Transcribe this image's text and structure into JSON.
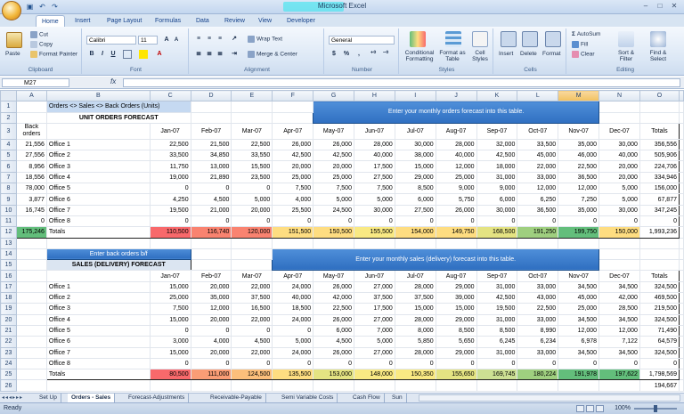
{
  "app": {
    "title": "Microsoft Excel",
    "quick_access": [
      "save-icon",
      "undo-icon",
      "redo-icon"
    ],
    "window_buttons": [
      "–",
      "□",
      "✕"
    ]
  },
  "ribbon_tabs": [
    "Home",
    "Insert",
    "Page Layout",
    "Formulas",
    "Data",
    "Review",
    "View",
    "Developer"
  ],
  "ribbon": {
    "clipboard": {
      "paste": "Paste",
      "cut": "Cut",
      "copy": "Copy",
      "format_painter": "Format Painter",
      "label": "Clipboard"
    },
    "font": {
      "name": "Calibri",
      "size": "11",
      "label": "Font",
      "bold": "B",
      "italic": "I",
      "underline": "U"
    },
    "alignment": {
      "wrap": "Wrap Text",
      "merge": "Merge & Center",
      "label": "Alignment"
    },
    "number": {
      "format": "General",
      "currency": "$",
      "percent": "%",
      "comma": ",",
      "label": "Number"
    },
    "styles": {
      "conditional": "Conditional Formatting",
      "format_table": "Format as Table",
      "cell_styles": "Cell Styles",
      "label": "Styles"
    },
    "cells": {
      "insert": "Insert",
      "delete": "Delete",
      "format": "Format",
      "label": "Cells"
    },
    "editing": {
      "autosum": "AutoSum",
      "fill": "Fill",
      "clear": "Clear",
      "sort": "Sort & Filter",
      "find": "Find & Select",
      "label": "Editing"
    }
  },
  "formula_bar": {
    "name_box": "M27",
    "fx": "fx",
    "formula": ""
  },
  "columns": [
    "A",
    "B",
    "C",
    "D",
    "E",
    "F",
    "G",
    "H",
    "I",
    "J",
    "K",
    "L",
    "M",
    "N",
    "O"
  ],
  "sheet": {
    "title1": "Orders <> Sales <> Back Orders (Units)",
    "unit_orders_title": "UNIT ORDERS FORECAST",
    "note_monthly_orders": "Enter your monthly  orders forecast into this table.",
    "back_orders_label": "Back orders",
    "months": [
      "Jan-07",
      "Feb-07",
      "Mar-07",
      "Apr-07",
      "May-07",
      "Jun-07",
      "Jul-07",
      "Aug-07",
      "Sep-07",
      "Oct-07",
      "Nov-07",
      "Dec-07"
    ],
    "totals_label": "Totals",
    "orders_rows": [
      {
        "row": "4",
        "back": "21,556",
        "office": "Office 1",
        "values": [
          "22,500",
          "21,500",
          "22,500",
          "26,000",
          "26,000",
          "28,000",
          "30,000",
          "28,000",
          "32,000",
          "33,500",
          "35,000",
          "30,000"
        ],
        "total": "356,556"
      },
      {
        "row": "5",
        "back": "27,556",
        "office": "Office 2",
        "values": [
          "33,500",
          "34,850",
          "33,550",
          "42,500",
          "42,500",
          "40,000",
          "38,000",
          "40,000",
          "42,500",
          "45,000",
          "46,000",
          "40,000"
        ],
        "total": "505,906"
      },
      {
        "row": "6",
        "back": "8,956",
        "office": "Office 3",
        "values": [
          "11,750",
          "13,000",
          "15,500",
          "20,000",
          "20,000",
          "17,500",
          "15,000",
          "12,000",
          "18,000",
          "22,000",
          "22,500",
          "20,000"
        ],
        "total": "224,706"
      },
      {
        "row": "7",
        "back": "18,556",
        "office": "Office 4",
        "values": [
          "19,000",
          "21,890",
          "23,500",
          "25,000",
          "25,000",
          "27,500",
          "29,000",
          "25,000",
          "31,000",
          "33,000",
          "36,500",
          "20,000"
        ],
        "total": "334,946"
      },
      {
        "row": "8",
        "back": "78,000",
        "office": "Office 5",
        "values": [
          "0",
          "0",
          "0",
          "7,500",
          "7,500",
          "7,500",
          "8,500",
          "9,000",
          "9,000",
          "12,000",
          "12,000",
          "5,000"
        ],
        "total": "156,000"
      },
      {
        "row": "9",
        "back": "3,877",
        "office": "Office 6",
        "values": [
          "4,250",
          "4,500",
          "5,000",
          "4,000",
          "5,000",
          "5,000",
          "6,000",
          "5,750",
          "6,000",
          "6,250",
          "7,250",
          "5,000"
        ],
        "total": "67,877"
      },
      {
        "row": "10",
        "back": "16,745",
        "office": "Office 7",
        "values": [
          "19,500",
          "21,000",
          "20,000",
          "25,500",
          "24,500",
          "30,000",
          "27,500",
          "26,000",
          "30,000",
          "36,500",
          "35,000",
          "30,000"
        ],
        "total": "347,245"
      },
      {
        "row": "11",
        "back": "0",
        "office": "Office 8",
        "values": [
          "0",
          "0",
          "0",
          "0",
          "0",
          "0",
          "0",
          "0",
          "0",
          "0",
          "0",
          "0"
        ],
        "total": "0"
      }
    ],
    "orders_totals": {
      "row": "12",
      "back": "175,246",
      "label": "Totals",
      "values": [
        "110,500",
        "116,740",
        "120,000",
        "151,500",
        "150,500",
        "155,500",
        "154,000",
        "149,750",
        "168,500",
        "191,250",
        "199,750",
        "150,000"
      ],
      "total": "1,993,236"
    },
    "note_back_orders": "Enter back orders b/f",
    "note_monthly_sales": "Enter your monthly sales (delivery) forecast into this table.",
    "sales_title": "SALES (DELIVERY) FORECAST",
    "sales_rows": [
      {
        "row": "17",
        "office": "Office 1",
        "values": [
          "15,000",
          "20,000",
          "22,000",
          "24,000",
          "26,000",
          "27,000",
          "28,000",
          "29,000",
          "31,000",
          "33,000",
          "34,500",
          "34,500"
        ],
        "total": "324,500"
      },
      {
        "row": "18",
        "office": "Office 2",
        "values": [
          "25,000",
          "35,000",
          "37,500",
          "40,000",
          "42,000",
          "37,500",
          "37,500",
          "39,000",
          "42,500",
          "43,000",
          "45,000",
          "42,000"
        ],
        "total": "469,500"
      },
      {
        "row": "19",
        "office": "Office 3",
        "values": [
          "7,500",
          "12,000",
          "16,500",
          "18,500",
          "22,500",
          "17,500",
          "15,000",
          "15,000",
          "19,500",
          "22,500",
          "25,000",
          "28,500"
        ],
        "total": "219,500"
      },
      {
        "row": "20",
        "office": "Office 4",
        "values": [
          "15,000",
          "20,000",
          "22,000",
          "24,000",
          "26,000",
          "27,000",
          "28,000",
          "29,000",
          "31,000",
          "33,000",
          "34,500",
          "34,500"
        ],
        "total": "324,500"
      },
      {
        "row": "21",
        "office": "Office 5",
        "values": [
          "0",
          "0",
          "0",
          "0",
          "6,000",
          "7,000",
          "8,000",
          "8,500",
          "8,500",
          "8,990",
          "12,000",
          "12,000"
        ],
        "total": "71,490"
      },
      {
        "row": "22",
        "office": "Office 6",
        "values": [
          "3,000",
          "4,000",
          "4,500",
          "5,000",
          "4,500",
          "5,000",
          "5,850",
          "5,650",
          "6,245",
          "6,234",
          "6,978",
          "7,122"
        ],
        "total": "64,579"
      },
      {
        "row": "23",
        "office": "Office 7",
        "values": [
          "15,000",
          "20,000",
          "22,000",
          "24,000",
          "26,000",
          "27,000",
          "28,000",
          "29,000",
          "31,000",
          "33,000",
          "34,500",
          "34,500"
        ],
        "total": "324,500"
      },
      {
        "row": "24",
        "office": "Office 8",
        "values": [
          "0",
          "0",
          "0",
          "0",
          "0",
          "0",
          "0",
          "0",
          "0",
          "0",
          "0",
          "0"
        ],
        "total": "0"
      }
    ],
    "sales_totals": {
      "row": "25",
      "label": "Totals",
      "values": [
        "80,500",
        "111,000",
        "124,500",
        "135,500",
        "153,000",
        "148,000",
        "150,350",
        "155,650",
        "169,745",
        "180,224",
        "191,978",
        "197,622"
      ],
      "total": "1,798,569"
    },
    "row26_total": "194,667"
  },
  "sheet_tabs": [
    "Set Up",
    "Orders - Sales",
    "Forecast-Adjustments",
    "Receivable-Payable",
    "Semi Variable Costs",
    "Cash Flow",
    "Sun"
  ],
  "status": {
    "ready": "Ready",
    "zoom": "100%"
  },
  "colors": {
    "accent": "#2f6fc1",
    "ribbon": "#dbe7f5"
  }
}
